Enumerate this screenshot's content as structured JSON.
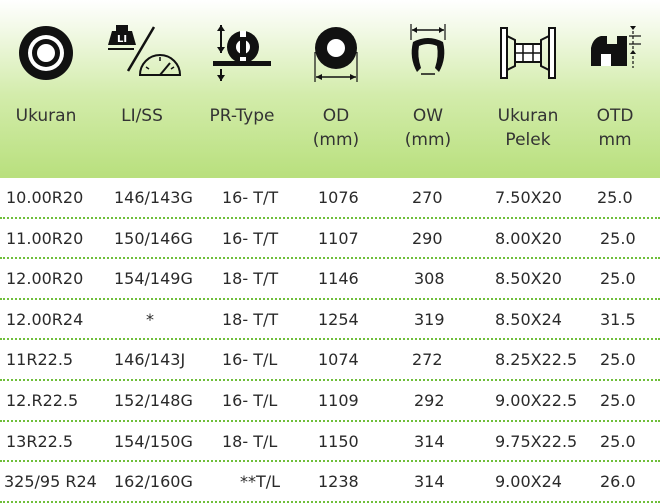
{
  "header": {
    "columns": [
      {
        "icon": "tire-icon",
        "label_lines": [
          "Ukuran"
        ]
      },
      {
        "icon": "load-speed-icon",
        "label_lines": [
          "LI/SS"
        ]
      },
      {
        "icon": "ply-rating-icon",
        "label_lines": [
          "PR-Type"
        ]
      },
      {
        "icon": "outer-diameter-icon",
        "label_lines": [
          "OD",
          "(mm)"
        ]
      },
      {
        "icon": "overall-width-icon",
        "label_lines": [
          "OW",
          "(mm)"
        ]
      },
      {
        "icon": "rim-size-icon",
        "label_lines": [
          "Ukuran",
          "Pelek"
        ]
      },
      {
        "icon": "tread-depth-icon",
        "label_lines": [
          "OTD",
          "mm"
        ]
      }
    ]
  },
  "icon_labels": {
    "li": "LI"
  },
  "colors": {
    "header_green": "#b9e07e",
    "divider_green": "#6fbf3a"
  },
  "rows": [
    {
      "ukuran": "10.00R20",
      "li_ss": "146/143G",
      "pr_type": "16- T/T",
      "od": "1076",
      "ow": "270",
      "pelek": "7.50X20",
      "otd": "25.0"
    },
    {
      "ukuran": "11.00R20",
      "li_ss": "150/146G",
      "pr_type": "16- T/T",
      "od": "1107",
      "ow": "290",
      "pelek": "8.00X20",
      "otd": "25.0"
    },
    {
      "ukuran": "12.00R20",
      "li_ss": "154/149G",
      "pr_type": "18- T/T",
      "od": "1146",
      "ow": "308",
      "pelek": "8.50X20",
      "otd": "25.0"
    },
    {
      "ukuran": "12.00R24",
      "li_ss": "*",
      "pr_type": "18- T/T",
      "od": "1254",
      "ow": "319",
      "pelek": "8.50X24",
      "otd": "31.5"
    },
    {
      "ukuran": "11R22.5",
      "li_ss": "146/143J",
      "pr_type": "16- T/L",
      "od": "1074",
      "ow": "272",
      "pelek": "8.25X22.5",
      "otd": "25.0"
    },
    {
      "ukuran": "12.R22.5",
      "li_ss": "152/148G",
      "pr_type": "16- T/L",
      "od": "1109",
      "ow": "292",
      "pelek": "9.00X22.5",
      "otd": "25.0"
    },
    {
      "ukuran": "13R22.5",
      "li_ss": "154/150G",
      "pr_type": "18- T/L",
      "od": "1150",
      "ow": "314",
      "pelek": "9.75X22.5",
      "otd": "25.0"
    },
    {
      "ukuran": "325/95 R24",
      "li_ss": "162/160G",
      "pr_type": "**T/L",
      "od": "1238",
      "ow": "314",
      "pelek": "9.00X24",
      "otd": "26.0"
    }
  ]
}
